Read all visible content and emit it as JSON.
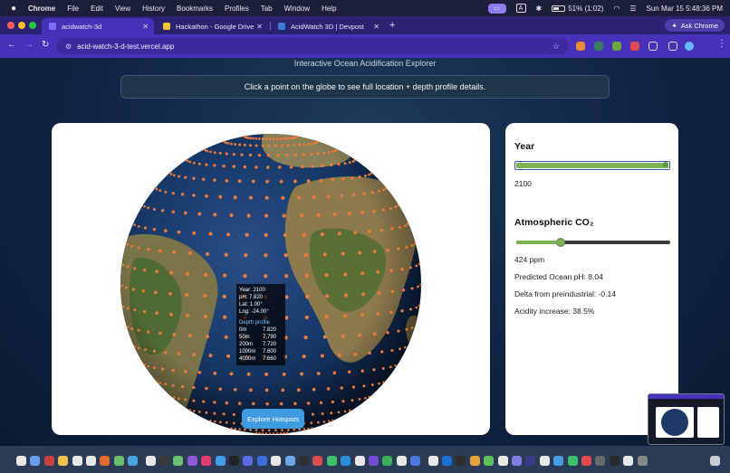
{
  "menubar": {
    "items": [
      "Chrome",
      "File",
      "Edit",
      "View",
      "History",
      "Bookmarks",
      "Profiles",
      "Tab",
      "Window",
      "Help"
    ],
    "status_pill": "▭",
    "status_a": "A",
    "battery": "51% (1:02)",
    "datetime": "Sun Mar 15  5:48:36 PM"
  },
  "tabs": [
    {
      "label": "acidwatch-3d",
      "active": true,
      "icon_color": "#7d6cff"
    },
    {
      "label": "Hackathon - Google Drive",
      "active": false,
      "icon_color": "#f1c232"
    },
    {
      "label": "AcidWatch 3D | Devpost",
      "active": false,
      "icon_color": "#3d7ad6"
    }
  ],
  "tab_close": "✕",
  "new_tab": "+",
  "ask_chrome": "Ask Chrome",
  "toolbar": {
    "back": "←",
    "forward": "→",
    "reload": "↻",
    "url": "acid-watch-3-d-test.vercel.app"
  },
  "page": {
    "subtitle": "Interactive Ocean Acidification Explorer",
    "hint": "Click a point on the globe to see full location + depth profile details.",
    "explore_button": "Explore Hotspots"
  },
  "tooltip": {
    "year": "Year: 2100",
    "ph": "pH: 7.820",
    "lat": "Lat: 1.00°",
    "lng": "Lng: -24.00°",
    "depth_title": "Depth profile",
    "depth_rows": [
      {
        "depth": "0m",
        "value": "7.820"
      },
      {
        "depth": "50m",
        "value": "7.790"
      },
      {
        "depth": "200m",
        "value": "7.720"
      },
      {
        "depth": "1000m",
        "value": "7.600"
      },
      {
        "depth": "4000m",
        "value": "7.660"
      }
    ]
  },
  "controls": {
    "year_heading": "Year",
    "year_value": "2100",
    "year_fraction": 1.0,
    "co2_heading": "Atmospheric CO₂",
    "co2_value": "424 ppm",
    "co2_fraction": 0.29,
    "predicted_ph": "Predicted Ocean pH: 8.04",
    "delta": "Delta from preindustrial: -0.14",
    "acidity": "Acidity increase: 38.5%"
  },
  "colors": {
    "accent_purple": "#4632b8",
    "slider_green": "#7db356",
    "button_blue": "#3e9be0",
    "point_orange": "#f07a3a"
  }
}
